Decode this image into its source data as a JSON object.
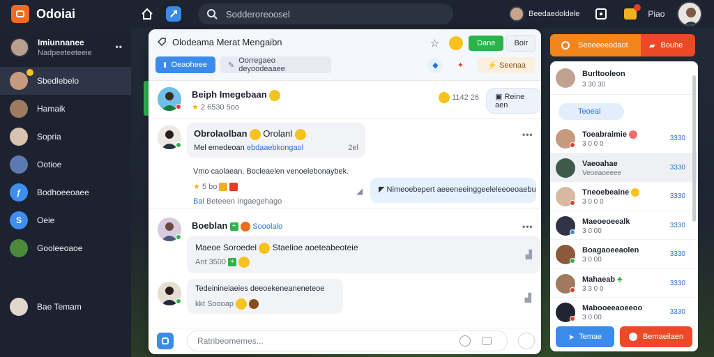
{
  "topbar": {
    "brand": "Odoiai",
    "search_placeholder": "Sodderoreoosel",
    "user_name": "Beedaedoldele",
    "play_label": "Piao"
  },
  "sidebar": {
    "header": {
      "title": "Imiunnanee",
      "subtitle": "Nadpeeteeteeie"
    },
    "items": [
      {
        "label": "Sbedlebelo",
        "icon": "team-avatar",
        "active": true
      },
      {
        "label": "Hamaik",
        "icon": "person-avatar",
        "active": false
      },
      {
        "label": "Sopria",
        "icon": "person-avatar",
        "active": false
      },
      {
        "label": "Ootioe",
        "icon": "group-avatar",
        "active": false
      },
      {
        "label": "Bodhoeeoaee",
        "icon": "blue-app-icon",
        "active": false
      },
      {
        "label": "Oeie",
        "icon": "blue-circle-icon",
        "active": false
      },
      {
        "label": "Gooleeoaoe",
        "icon": "ball-avatar",
        "active": false
      }
    ],
    "bottom_user": "Bae Temam"
  },
  "chat": {
    "title": "Olodeama Merat Mengaibn",
    "green_pill": "Dane",
    "light_pill": "Boir",
    "tab_primary": "Oeaoheee",
    "tab_secondary": "Oorregaeo deyoodeaaee",
    "summary_btn": "Seenaa",
    "pinned": {
      "name": "Beiph Imegebaan",
      "meta": "2 6530 5oo",
      "count": "1142 26",
      "reply_btn": "Reine aen"
    },
    "messages": [
      {
        "name": "Obrolaolban",
        "alt_name": "Orolanl",
        "line": "Mel emedeoan",
        "link": "ebdaaebkongaol",
        "time": "2el",
        "body": "Vmo caolaean. Bocleaelen venoelebonaybek.",
        "reactions": "5 bo",
        "footer_link": "Bal",
        "footer_text": "Beteeen Ingaegehago",
        "quote": "Nimeoebepert aeeeneeinggeeleleeoeoaebu"
      },
      {
        "name": "Boeblan",
        "tag": "Sooolalo",
        "bubble_text": "Maeoe Soroedel",
        "bubble_text_2": "Staelioe aoeteabeoteie",
        "bubble_meta": "Ant 3500"
      },
      {
        "bubble_text": "Tedeinineiaeies deeoekeneaneneteoe",
        "bubble_meta": "kkt Soooap"
      }
    ],
    "composer_placeholder": "Ratribeomemes..."
  },
  "right_panel": {
    "top_orange": "Seoeeeeodaot",
    "top_red": "Bouhe",
    "header": {
      "title": "Burltooleon",
      "subtitle": "3 30 30"
    },
    "tab": "Teoeal",
    "contacts": [
      {
        "name": "Toeabraimie",
        "sub": "3 0 0 0",
        "num": "3330",
        "status": "red"
      },
      {
        "name": "Vaeoahae",
        "sub": "Veoeaoeeee",
        "num": "3330",
        "status": "none"
      },
      {
        "name": "Tneoebeaine",
        "sub": "3 0 0 0",
        "num": "3330",
        "status": "red"
      },
      {
        "name": "Maeoeoeealk",
        "sub": "3 0 00",
        "num": "3330",
        "status": "blue"
      },
      {
        "name": "Boagaoeeaolen",
        "sub": "3 0 00",
        "num": "3330",
        "status": "green"
      },
      {
        "name": "Mahaeab",
        "sub": "3 3 0 0",
        "num": "3330",
        "status": "red"
      },
      {
        "name": "Mabooeeaoeeoo",
        "sub": "3 0 00",
        "num": "3330",
        "status": "red"
      }
    ],
    "btn_blue": "Temae",
    "btn_red": "Bemaeilaen"
  },
  "colors": {
    "accent_blue": "#3b8bea",
    "accent_orange": "#f4841c",
    "accent_red": "#ec4a26",
    "accent_green": "#29b34a"
  }
}
